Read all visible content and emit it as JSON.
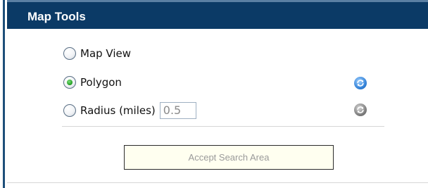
{
  "panel": {
    "title": "Map Tools"
  },
  "options": {
    "map_view": {
      "label": "Map View",
      "checked": false
    },
    "polygon": {
      "label": "Polygon",
      "checked": true
    },
    "radius": {
      "label": "Radius (miles)",
      "checked": false,
      "value": "0.5"
    }
  },
  "icons": {
    "polygon_refresh": {
      "name": "refresh-icon",
      "color": "#2f7fd6",
      "state": "active"
    },
    "radius_refresh": {
      "name": "refresh-icon",
      "color": "#7a7a7a",
      "state": "inactive"
    }
  },
  "actions": {
    "accept_label": "Accept Search Area"
  },
  "colors": {
    "titlebar": "#0b3a66",
    "accent_border": "#1e4f7a"
  }
}
